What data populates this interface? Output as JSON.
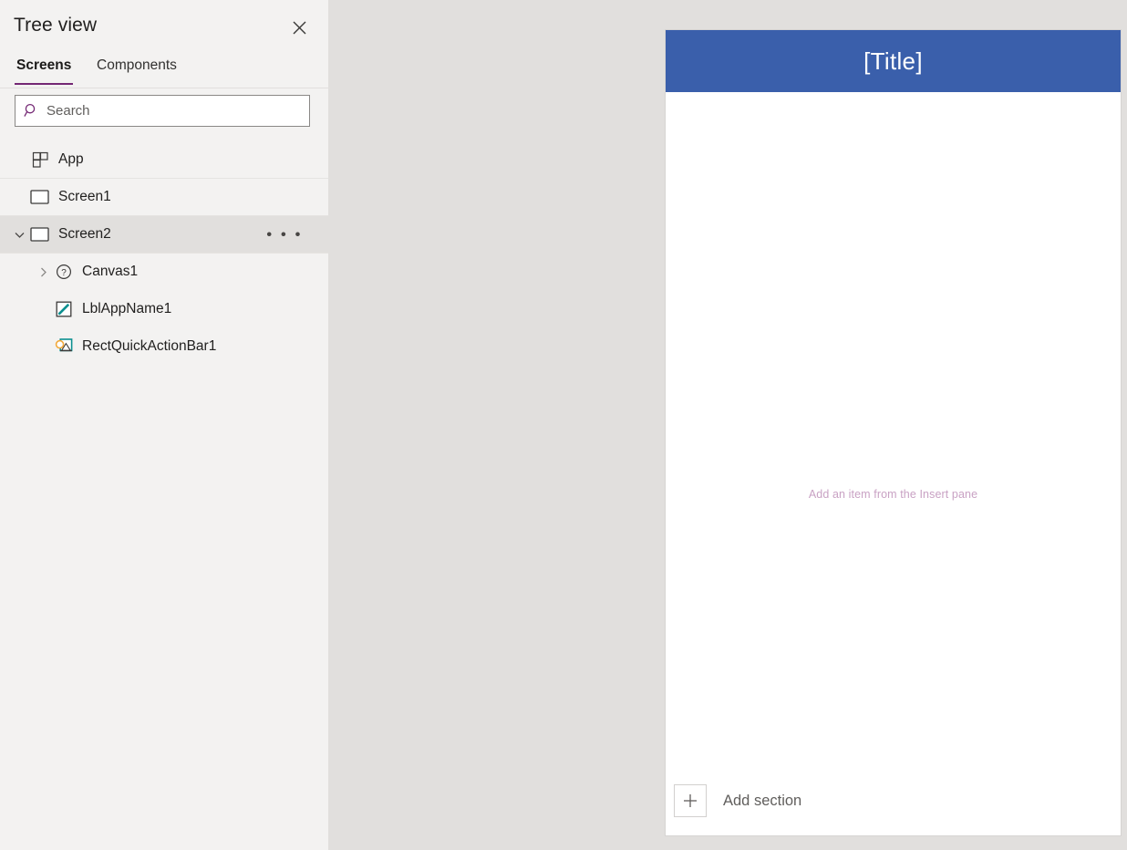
{
  "pane": {
    "title": "Tree view",
    "close_icon": "close-icon",
    "tabs": [
      {
        "label": "Screens",
        "active": true
      },
      {
        "label": "Components",
        "active": false
      }
    ],
    "search": {
      "placeholder": "Search",
      "value": "",
      "icon": "search-icon"
    },
    "tree": [
      {
        "label": "App",
        "icon": "app-grid-icon",
        "level": 0,
        "chevron": "none",
        "selected": false,
        "divider": true,
        "more": false
      },
      {
        "label": "Screen1",
        "icon": "screen-rect-icon",
        "level": 0,
        "chevron": "none",
        "selected": false,
        "divider": true,
        "more": false
      },
      {
        "label": "Screen2",
        "icon": "screen-rect-icon",
        "level": 0,
        "chevron": "down",
        "selected": true,
        "divider": true,
        "more": true,
        "more_label": "• • •"
      },
      {
        "label": "Canvas1",
        "icon": "question-circle-icon",
        "level": 1,
        "chevron": "right",
        "selected": false,
        "divider": false,
        "more": false
      },
      {
        "label": "LblAppName1",
        "icon": "label-pencil-icon",
        "level": 1,
        "chevron": "none",
        "selected": false,
        "divider": false,
        "more": false
      },
      {
        "label": "RectQuickActionBar1",
        "icon": "image-shape-icon",
        "level": 1,
        "chevron": "none",
        "selected": false,
        "divider": false,
        "more": false
      }
    ]
  },
  "canvas": {
    "title": "[Title]",
    "empty_hint": "Add an item from the Insert pane",
    "add_section_label": "Add section",
    "add_section_icon": "plus-icon"
  },
  "colors": {
    "accent_purple": "#742774",
    "title_bar_blue": "#3a5fab",
    "pane_bg": "#f3f2f1",
    "canvas_bg": "#e1dfdd",
    "hint_mauve": "#c9a2c4",
    "icon_teal": "#0b8f8f",
    "icon_orange": "#f2a93b"
  }
}
